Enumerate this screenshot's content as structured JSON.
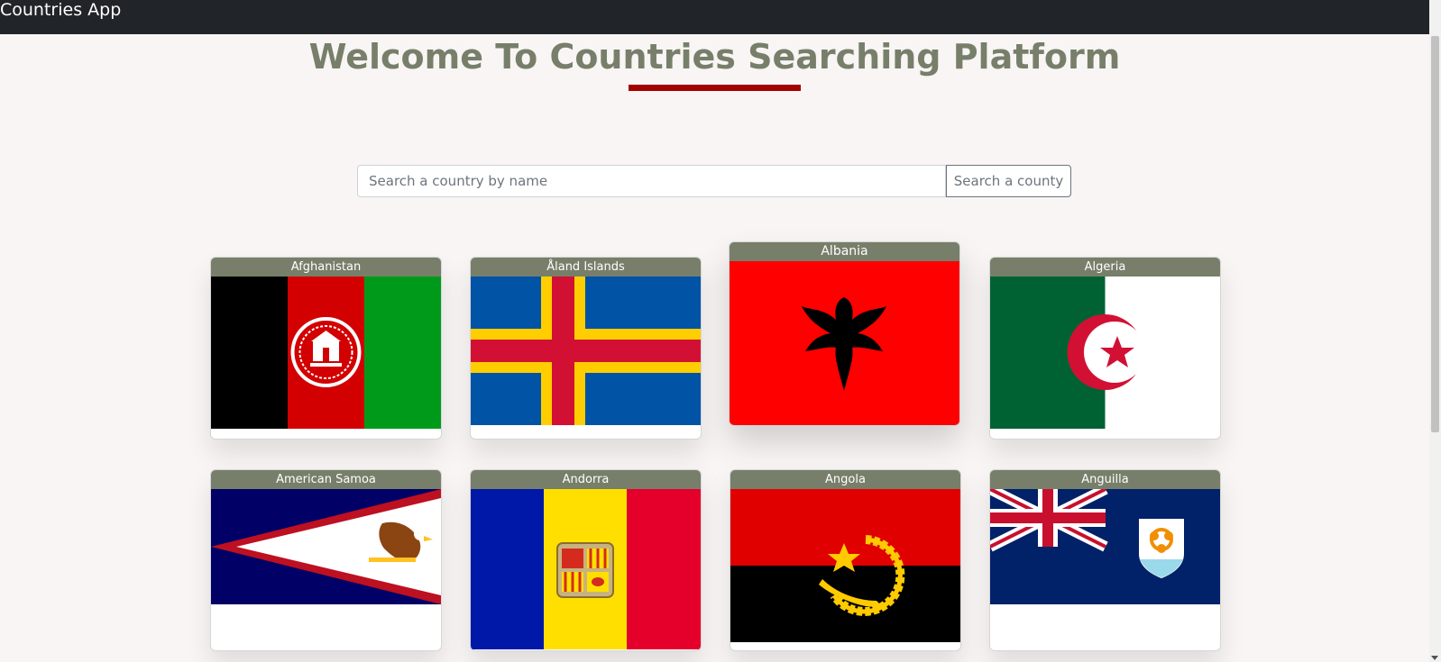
{
  "app": {
    "brand": "Countries App"
  },
  "page": {
    "title": "Welcome To Countries Searching Platform"
  },
  "search": {
    "placeholder": "Search a country by name",
    "button_label": "Search a county"
  },
  "countries": [
    {
      "name": "Afghanistan",
      "flag_icon": "afghanistan-flag-icon"
    },
    {
      "name": "Åland Islands",
      "flag_icon": "aland-islands-flag-icon"
    },
    {
      "name": "Albania",
      "flag_icon": "albania-flag-icon"
    },
    {
      "name": "Algeria",
      "flag_icon": "algeria-flag-icon"
    },
    {
      "name": "American Samoa",
      "flag_icon": "american-samoa-flag-icon"
    },
    {
      "name": "Andorra",
      "flag_icon": "andorra-flag-icon"
    },
    {
      "name": "Angola",
      "flag_icon": "angola-flag-icon"
    },
    {
      "name": "Anguilla",
      "flag_icon": "anguilla-flag-icon"
    }
  ],
  "colors": {
    "navbar": "#212529",
    "accent": "#a30000",
    "header": "#777f6a",
    "background": "#f8f5f4"
  }
}
